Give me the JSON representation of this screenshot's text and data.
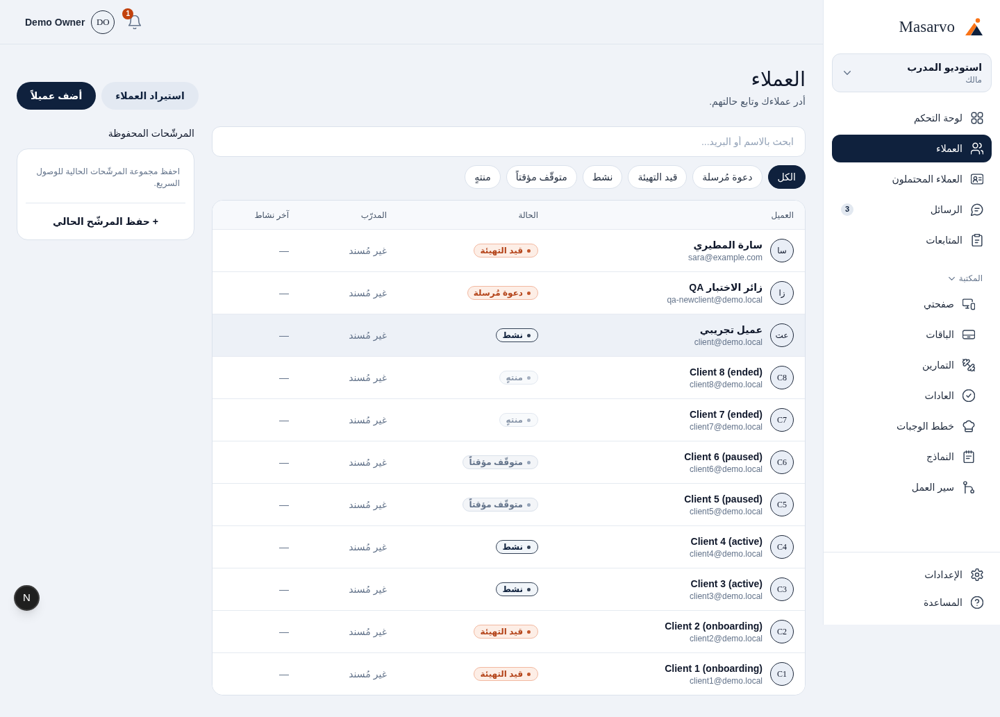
{
  "sidebar": {
    "logo": {
      "text": "Masarvo"
    },
    "workspace": {
      "name": "استوديو المدرب",
      "role": "مالك"
    },
    "nav": [
      {
        "label": "لوحة التحكم",
        "selected": false
      },
      {
        "label": "العملاء",
        "selected": true
      },
      {
        "label": "العملاء المحتملون",
        "selected": false
      },
      {
        "label": "الرسائل",
        "selected": false,
        "badge": "3"
      },
      {
        "label": "المتابعات",
        "selected": false
      }
    ],
    "library": {
      "title": "المكتبة",
      "expanded": true,
      "items": [
        {
          "label": "صفحتي",
          "selected": false
        },
        {
          "label": "الباقات",
          "selected": false
        },
        {
          "label": "التمارين",
          "selected": false
        },
        {
          "label": "العادات",
          "selected": false
        },
        {
          "label": "خطط الوجبات",
          "selected": false
        },
        {
          "label": "النماذج",
          "selected": false
        },
        {
          "label": "سير العمل",
          "selected": false
        }
      ]
    },
    "footer": [
      {
        "label": "الإعدادات",
        "selected": false
      },
      {
        "label": "المساعدة",
        "selected": false
      }
    ]
  },
  "topbar": {
    "user_name": "Demo Owner",
    "avatar_initials": "DO",
    "notifications": {
      "count": "1"
    }
  },
  "page": {
    "title": "العملاء",
    "subtitle": "أدر عملاءك وتابع حالتهم.",
    "actions": [
      {
        "label": "استيراد العملاء",
        "kind": "secondary"
      },
      {
        "label": "أضف عميلاً",
        "kind": "primary"
      }
    ]
  },
  "search": {
    "placeholder": "ابحث بالاسم أو البريد..."
  },
  "filters": [
    {
      "label": "الكل",
      "selected": true
    },
    {
      "label": "دعوة مُرسلة",
      "selected": false
    },
    {
      "label": "قيد التهيئة",
      "selected": false
    },
    {
      "label": "نشط",
      "selected": false
    },
    {
      "label": "متوقّف مؤقتاً",
      "selected": false
    },
    {
      "label": "منتهٍ",
      "selected": false
    }
  ],
  "table": {
    "columns": [
      "العميل",
      "الحالة",
      "المدرّب",
      "آخر نشاط"
    ],
    "rows": [
      {
        "initials": "سا",
        "name": "سارة المطيري",
        "email": "sara@example.com",
        "status": {
          "label": "قيد التهيئة",
          "kind": "onboarding"
        },
        "coach": "غير مُسند",
        "last_activity": "—",
        "highlighted": false
      },
      {
        "initials": "زا",
        "name": "زائر الاختبار QA",
        "email": "qa-newclient@demo.local",
        "status": {
          "label": "دعوة مُرسلة",
          "kind": "invited"
        },
        "coach": "غير مُسند",
        "last_activity": "—",
        "highlighted": false
      },
      {
        "initials": "عت",
        "name": "عميل تجريبي",
        "email": "client@demo.local",
        "status": {
          "label": "نشط",
          "kind": "active"
        },
        "coach": "غير مُسند",
        "last_activity": "—",
        "highlighted": true
      },
      {
        "initials": "C8",
        "name": "Client 8 (ended)",
        "email": "client8@demo.local",
        "status": {
          "label": "منتهٍ",
          "kind": "ended"
        },
        "coach": "غير مُسند",
        "last_activity": "—",
        "highlighted": false
      },
      {
        "initials": "C7",
        "name": "Client 7 (ended)",
        "email": "client7@demo.local",
        "status": {
          "label": "منتهٍ",
          "kind": "ended"
        },
        "coach": "غير مُسند",
        "last_activity": "—",
        "highlighted": false
      },
      {
        "initials": "C6",
        "name": "Client 6 (paused)",
        "email": "client6@demo.local",
        "status": {
          "label": "متوقّف مؤقتاً",
          "kind": "paused"
        },
        "coach": "غير مُسند",
        "last_activity": "—",
        "highlighted": false
      },
      {
        "initials": "C5",
        "name": "Client 5 (paused)",
        "email": "client5@demo.local",
        "status": {
          "label": "متوقّف مؤقتاً",
          "kind": "paused"
        },
        "coach": "غير مُسند",
        "last_activity": "—",
        "highlighted": false
      },
      {
        "initials": "C4",
        "name": "Client 4 (active)",
        "email": "client4@demo.local",
        "status": {
          "label": "نشط",
          "kind": "active"
        },
        "coach": "غير مُسند",
        "last_activity": "—",
        "highlighted": false
      },
      {
        "initials": "C3",
        "name": "Client 3 (active)",
        "email": "client3@demo.local",
        "status": {
          "label": "نشط",
          "kind": "active"
        },
        "coach": "غير مُسند",
        "last_activity": "—",
        "highlighted": false
      },
      {
        "initials": "C2",
        "name": "Client 2 (onboarding)",
        "email": "client2@demo.local",
        "status": {
          "label": "قيد التهيئة",
          "kind": "onboarding"
        },
        "coach": "غير مُسند",
        "last_activity": "—",
        "highlighted": false
      },
      {
        "initials": "C1",
        "name": "Client 1 (onboarding)",
        "email": "client1@demo.local",
        "status": {
          "label": "قيد التهيئة",
          "kind": "onboarding"
        },
        "coach": "غير مُسند",
        "last_activity": "—",
        "highlighted": false
      }
    ]
  },
  "saved_filters": {
    "title": "المرشّحات المحفوظة",
    "hint": "احفظ مجموعة المرشّحات الحالية للوصول السريع.",
    "action": "+ حفظ المرشّح الحالي"
  },
  "dev_indicator": {
    "label": "N"
  }
}
